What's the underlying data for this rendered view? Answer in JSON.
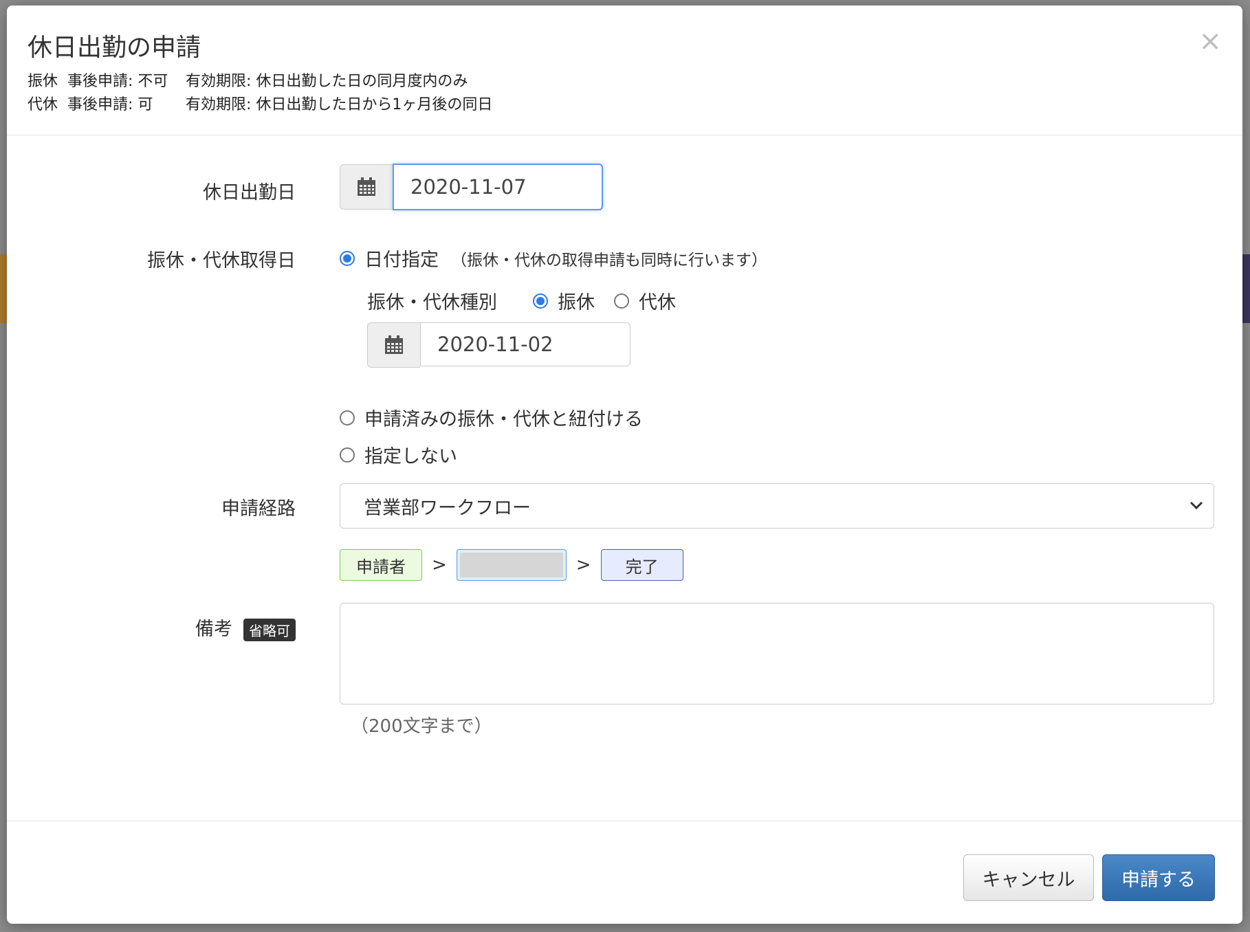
{
  "modal": {
    "title": "休日出勤の申請",
    "close_label": "×"
  },
  "notices": [
    {
      "type": "振休",
      "after": "事後申請: 不可",
      "validity": "有効期限: 休日出勤した日の同月度内のみ"
    },
    {
      "type": "代休",
      "after": "事後申請: 可",
      "validity": "有効期限: 休日出勤した日から1ヶ月後の同日"
    }
  ],
  "form": {
    "work_date": {
      "label": "休日出勤日",
      "value": "2020-11-07"
    },
    "substitute": {
      "label": "振休・代休取得日",
      "option_date": "日付指定",
      "option_date_note": "（振休・代休の取得申請も同時に行います）",
      "kind_label": "振休・代休種別",
      "kind_options": [
        "振休",
        "代休"
      ],
      "kind_selected": "振休",
      "date_value": "2020-11-02",
      "option_link": "申請済みの振休・代休と紐付ける",
      "option_none": "指定しない"
    },
    "route": {
      "label": "申請経路",
      "selected": "営業部ワークフロー",
      "steps": {
        "applicant": "申請者",
        "approver": "",
        "done": "完了"
      },
      "separator": ">"
    },
    "remarks": {
      "label": "備考",
      "badge": "省略可",
      "value": "",
      "help": "（200文字まで）"
    }
  },
  "footer": {
    "cancel_label": "キャンセル",
    "submit_label": "申請する"
  },
  "colors": {
    "accent": "#2f7ae5",
    "submit": "#3a78b8"
  }
}
